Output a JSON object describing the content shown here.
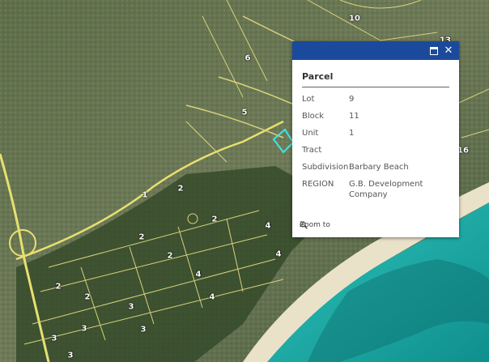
{
  "map": {
    "lot_labels": [
      "10",
      "6",
      "5",
      "1",
      "2",
      "2",
      "2",
      "2",
      "2",
      "2",
      "4",
      "4",
      "4",
      "4",
      "3",
      "3",
      "3",
      "3",
      "3",
      "16",
      "13"
    ],
    "colors": {
      "parcel_line": "#d8d27a",
      "road": "#e8e070",
      "selection": "#3ee6e6",
      "sea": "#1fb5b0",
      "beach": "#e9e2c9"
    }
  },
  "popup": {
    "header_color": "#1b4a9c",
    "maximize_icon": "maximize-icon",
    "close_icon": "close-icon",
    "close_glyph": "✕",
    "title": "Parcel",
    "fields": [
      {
        "key": "Lot",
        "value": "9"
      },
      {
        "key": "Block",
        "value": "11"
      },
      {
        "key": "Unit",
        "value": "1"
      },
      {
        "key": "Tract",
        "value": ""
      },
      {
        "key": "Subdivision",
        "value": "Barbary Beach"
      },
      {
        "key": "REGION",
        "value": "G.B. Development Company"
      }
    ],
    "zoom_label": "Zoom to",
    "zoom_icon": "magnifier-icon"
  }
}
